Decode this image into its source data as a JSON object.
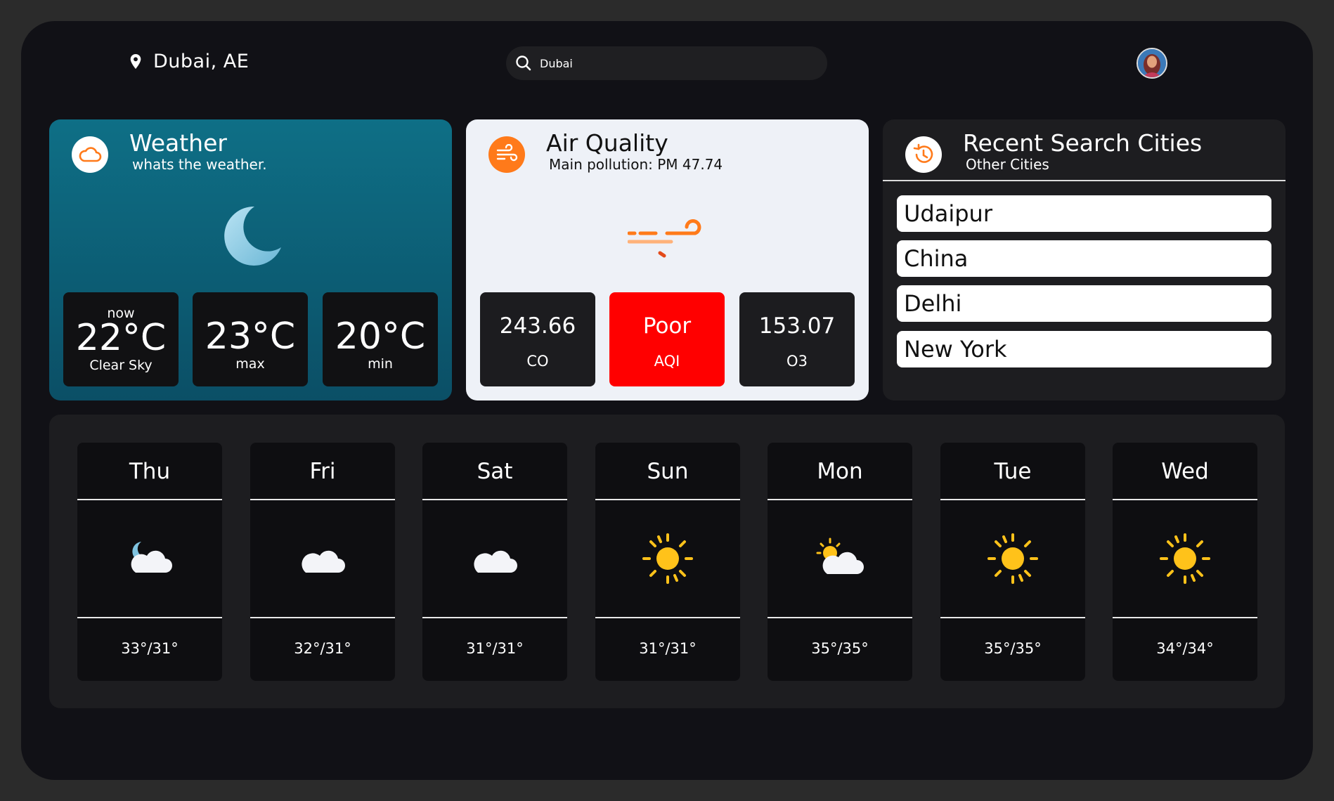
{
  "header": {
    "location": "Dubai, AE",
    "search_value": "Dubai"
  },
  "weather": {
    "title": "Weather",
    "subtitle": "whats the weather.",
    "now_label": "now",
    "now_temp": "22°C",
    "now_desc": "Clear Sky",
    "max_temp": "23°C",
    "max_label": "max",
    "min_temp": "20°C",
    "min_label": "min"
  },
  "air": {
    "title": "Air Quality",
    "subtitle": "Main pollution: PM 47.74",
    "co_value": "243.66",
    "co_label": "CO",
    "aqi_value": "Poor",
    "aqi_label": "AQI",
    "o3_value": "153.07",
    "o3_label": "O3",
    "accent": "#ff7a1a",
    "poor_color": "#ff0000"
  },
  "recent": {
    "title": "Recent Search Cities",
    "subtitle": "Other Cities",
    "cities": [
      "Udaipur",
      "China",
      "Delhi",
      "New York"
    ]
  },
  "forecast": [
    {
      "day": "Thu",
      "icon": "moon-cloud-icon",
      "temp": "33°/31°"
    },
    {
      "day": "Fri",
      "icon": "cloud-icon",
      "temp": "32°/31°"
    },
    {
      "day": "Sat",
      "icon": "cloud-icon",
      "temp": "31°/31°"
    },
    {
      "day": "Sun",
      "icon": "sun-icon",
      "temp": "31°/31°"
    },
    {
      "day": "Mon",
      "icon": "sun-cloud-icon",
      "temp": "35°/35°"
    },
    {
      "day": "Tue",
      "icon": "sun-icon",
      "temp": "35°/35°"
    },
    {
      "day": "Wed",
      "icon": "sun-icon",
      "temp": "34°/34°"
    }
  ]
}
